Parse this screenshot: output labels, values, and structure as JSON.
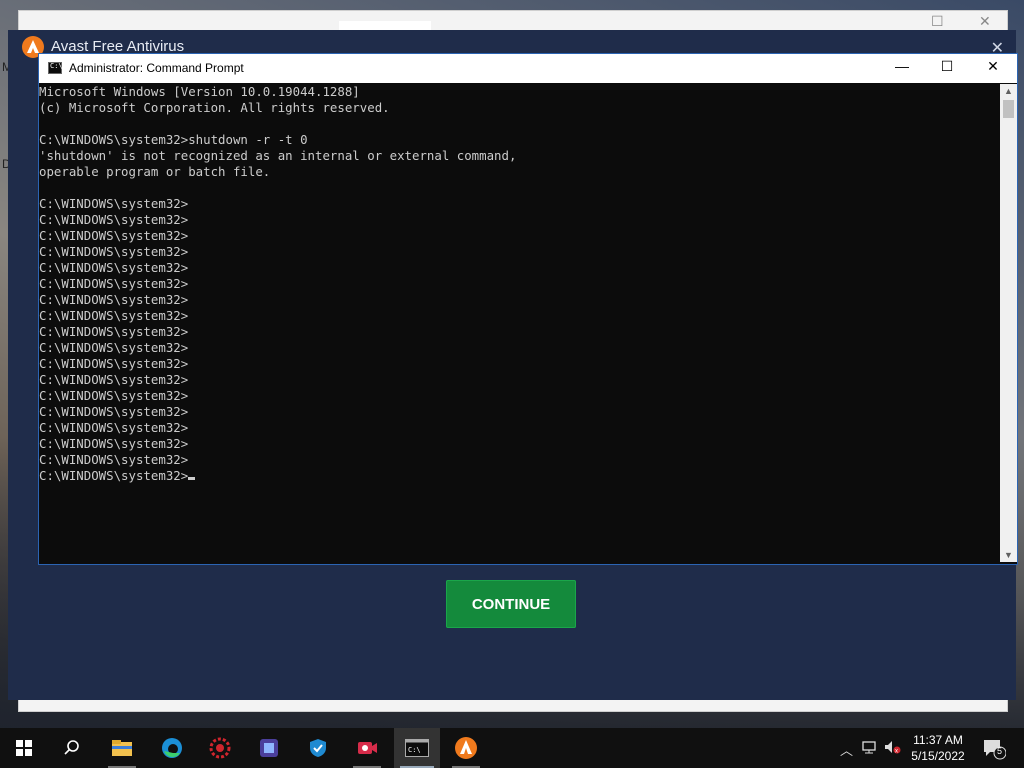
{
  "desktop": {
    "edge_letters": [
      "M",
      "D"
    ]
  },
  "avast": {
    "title": "Avast Free Antivirus",
    "close_label": "✕",
    "continue_label": "CONTINUE",
    "colors": {
      "bg": "#1f2c4a",
      "button": "#148a3c",
      "logo": "#f07a1d"
    }
  },
  "cmd": {
    "title": "Administrator: Command Prompt",
    "minimize_label": "—",
    "maximize_label": "☐",
    "close_label": "✕",
    "lines": [
      "Microsoft Windows [Version 10.0.19044.1288]",
      "(c) Microsoft Corporation. All rights reserved.",
      "",
      "C:\\WINDOWS\\system32>shutdown -r -t 0",
      "'shutdown' is not recognized as an internal or external command,",
      "operable program or batch file.",
      "",
      "C:\\WINDOWS\\system32>",
      "C:\\WINDOWS\\system32>",
      "C:\\WINDOWS\\system32>",
      "C:\\WINDOWS\\system32>",
      "C:\\WINDOWS\\system32>",
      "C:\\WINDOWS\\system32>",
      "C:\\WINDOWS\\system32>",
      "C:\\WINDOWS\\system32>",
      "C:\\WINDOWS\\system32>",
      "C:\\WINDOWS\\system32>",
      "C:\\WINDOWS\\system32>",
      "C:\\WINDOWS\\system32>",
      "C:\\WINDOWS\\system32>",
      "C:\\WINDOWS\\system32>",
      "C:\\WINDOWS\\system32>",
      "C:\\WINDOWS\\system32>",
      "C:\\WINDOWS\\system32>",
      "C:\\WINDOWS\\system32>"
    ]
  },
  "taskbar": {
    "items": [
      {
        "name": "start-button",
        "icon": "windows-logo-icon"
      },
      {
        "name": "search-button",
        "icon": "search-icon"
      },
      {
        "name": "taskbar-file-explorer",
        "icon": "folder-icon"
      },
      {
        "name": "taskbar-edge",
        "icon": "edge-icon"
      },
      {
        "name": "taskbar-app-red",
        "icon": "gear-red-icon"
      },
      {
        "name": "taskbar-app-purple",
        "icon": "app-purple-icon"
      },
      {
        "name": "taskbar-app-shield",
        "icon": "shield-icon"
      },
      {
        "name": "taskbar-app-camera",
        "icon": "camera-icon"
      },
      {
        "name": "taskbar-cmd",
        "icon": "cmd-icon"
      },
      {
        "name": "taskbar-avast",
        "icon": "avast-icon"
      }
    ],
    "time": "11:37 AM",
    "date": "5/15/2022",
    "notification_count": "5"
  }
}
